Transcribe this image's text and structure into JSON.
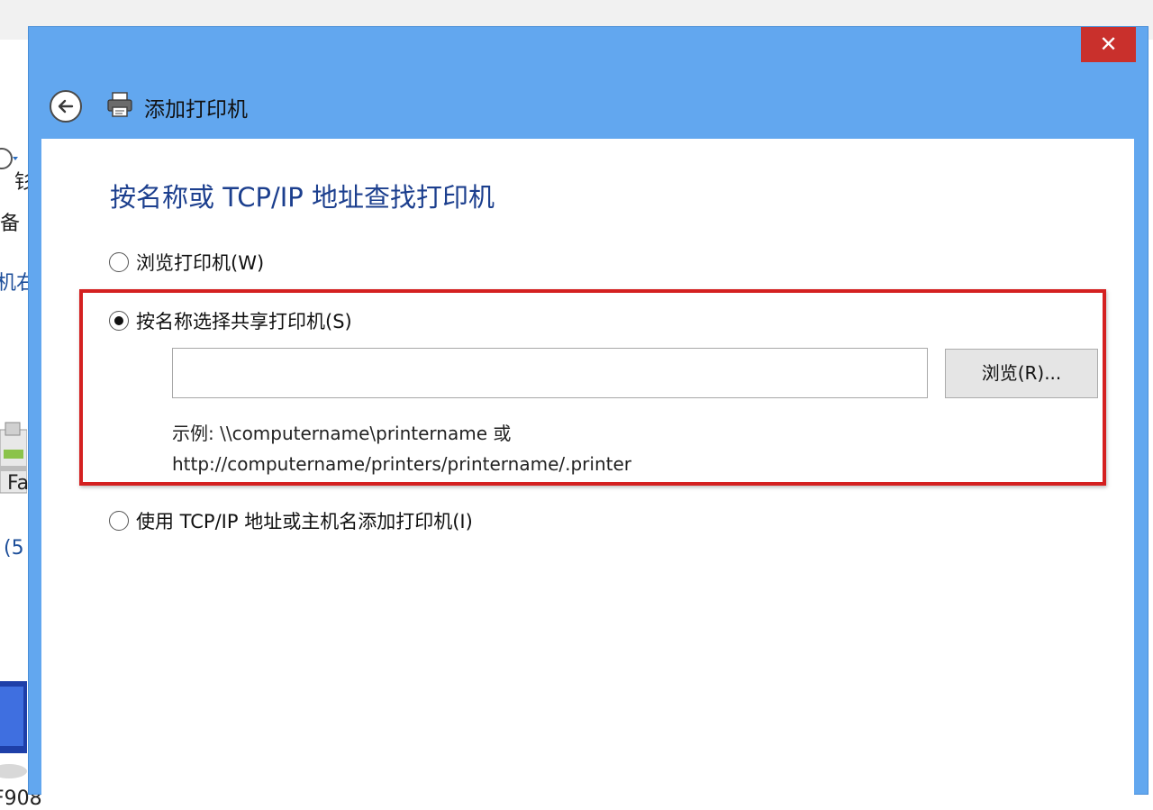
{
  "background": {
    "fragments": [
      "钐",
      "备",
      "机右",
      "Fa",
      "(5",
      "F908"
    ]
  },
  "dialog": {
    "title": "添加打印机",
    "close_label": "✕",
    "heading": "按名称或 TCP/IP 地址查找打印机",
    "options": [
      {
        "label": "浏览打印机(W)",
        "checked": false
      },
      {
        "label": "按名称选择共享打印机(S)",
        "checked": true
      },
      {
        "label": "使用 TCP/IP 地址或主机名添加打印机(I)",
        "checked": false
      }
    ],
    "name_input": {
      "value": "",
      "placeholder": ""
    },
    "browse_button": "浏览(R)...",
    "example_line1": "示例: \\\\computername\\printername 或",
    "example_line2": "http://computername/printers/printername/.printer",
    "highlight_color": "#d42020",
    "titlebar_color": "#62a7ef"
  }
}
